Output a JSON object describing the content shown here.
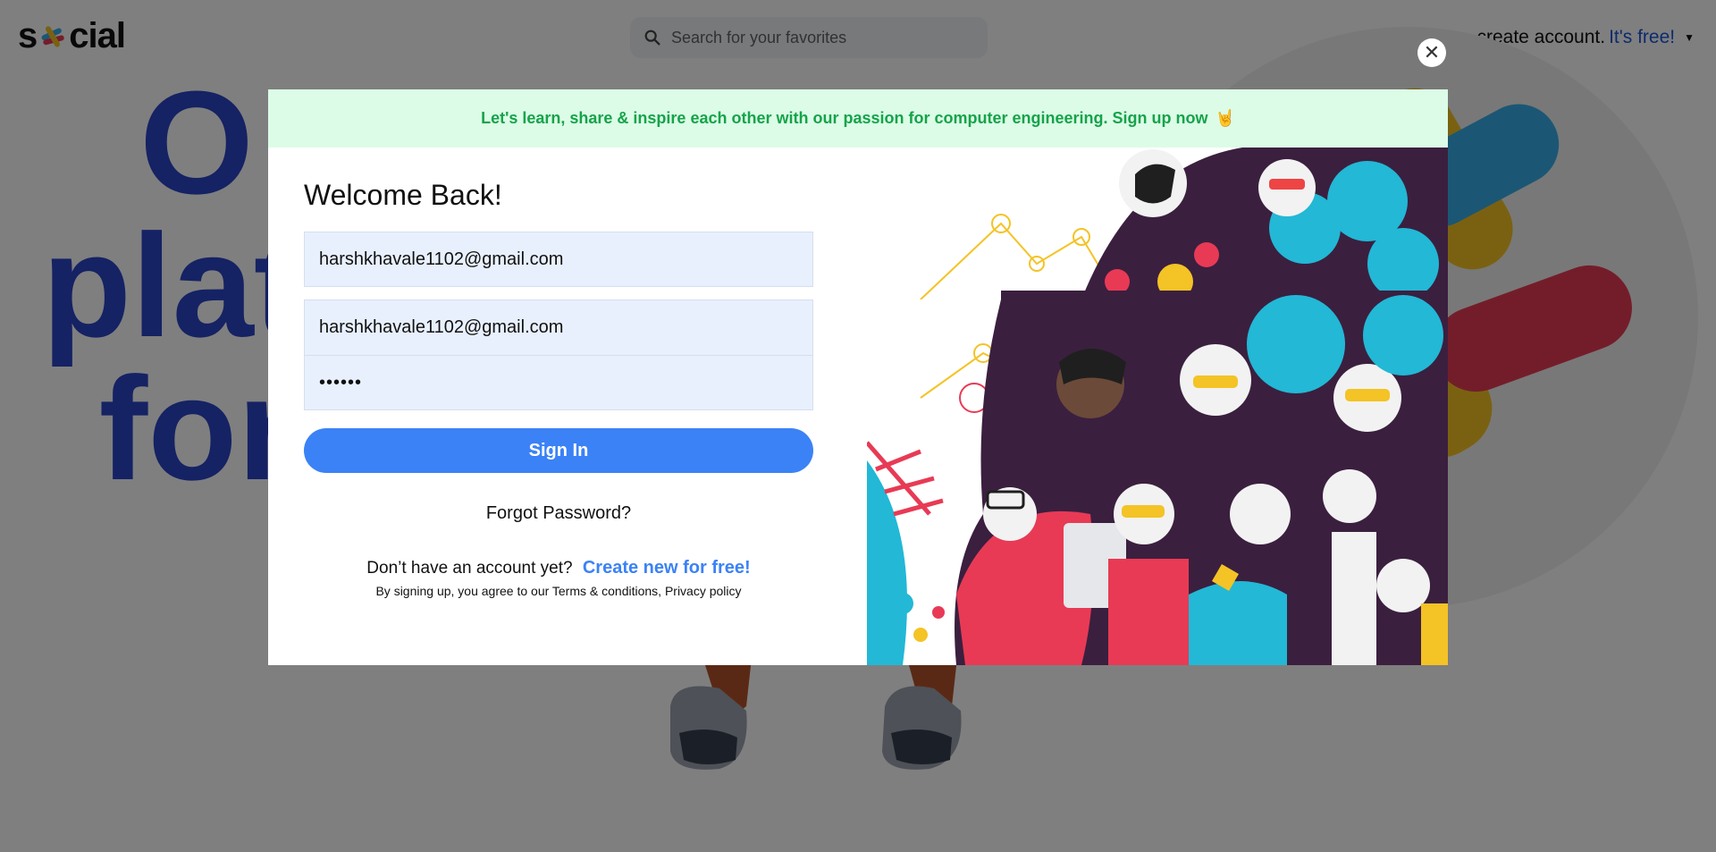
{
  "header": {
    "logo": {
      "prefix": "s",
      "suffix": "cial"
    },
    "search": {
      "placeholder": "Search for your favorites"
    },
    "create_account": {
      "label": "create account.",
      "highlight": "It's free!"
    }
  },
  "hero": {
    "line1": "O",
    "line2": "platf",
    "line3": "for"
  },
  "modal": {
    "banner": {
      "text": "Let's learn, share & inspire each other with our passion for computer engineering. Sign up now",
      "emoji": "🤘"
    },
    "title": "Welcome Back!",
    "email_top": "harshkhavale1102@gmail.com",
    "email": "harshkhavale1102@gmail.com",
    "password": "••••••",
    "sign_in_label": "Sign In",
    "forgot_label": "Forgot Password?",
    "no_account": "Don’t have an account yet?",
    "create_new": "Create new for free!",
    "terms": "By signing up, you agree to our Terms & conditions, Privacy policy"
  },
  "colors": {
    "accent": "#3b82f6",
    "banner_bg": "#dcfce7",
    "banner_text": "#16a34a",
    "hero_text": "#2b44c9",
    "input_bg": "#e8f0fe"
  }
}
